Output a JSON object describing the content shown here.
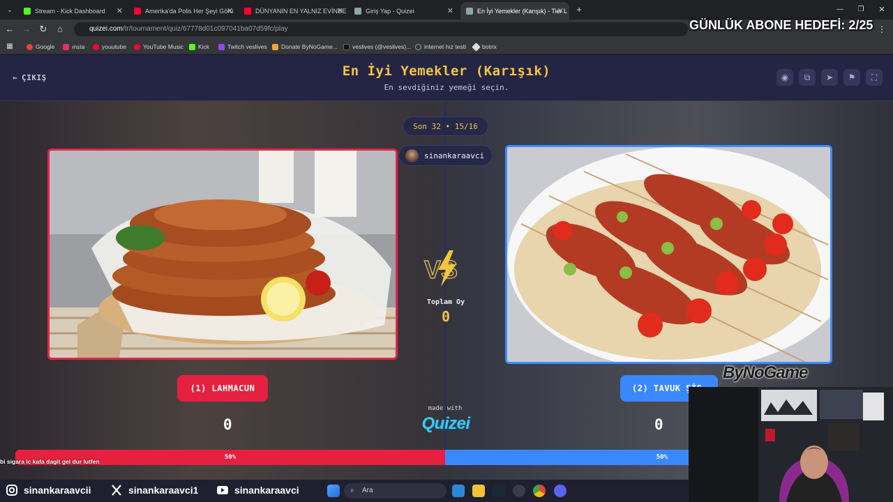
{
  "browser": {
    "tabs": [
      {
        "title": "Stream - Kick Dashboard",
        "color": "#53fc18"
      },
      {
        "title": "Amerika'da Polis Her Şeyi Görü",
        "color": "#ff0033"
      },
      {
        "title": "DÜNYANIN EN YALNIZ EVİNDE",
        "color": "#ff0033"
      },
      {
        "title": "Giriş Yap - Quizei",
        "color": "#9aa0a6"
      },
      {
        "title": "En İyi Yemekler (Karışık) - Tier L",
        "color": "#9aa0a6"
      }
    ],
    "url_host": "quizei.com",
    "url_path": "/tr/tournament/quiz/67778d01c097041ba07d59fc/play",
    "bookmarks": [
      {
        "label": "Google",
        "color": "#ea4335"
      },
      {
        "label": "ınsta",
        "color": "#e1306c"
      },
      {
        "label": "youutube",
        "color": "#ff0033"
      },
      {
        "label": "YouTube Music",
        "color": "#ff0033"
      },
      {
        "label": "Kick",
        "color": "#53fc18"
      },
      {
        "label": "Twitch veslives",
        "color": "#9146ff"
      },
      {
        "label": "Donate ByNoGame...",
        "color": "#f2a33a"
      },
      {
        "label": "veslives (@veslives)...",
        "color": "#111111"
      },
      {
        "label": "internet hız testi",
        "color": "#9aa0a6"
      },
      {
        "label": "botrix",
        "color": "#dddddd"
      }
    ]
  },
  "overlay": {
    "goal": "GÜNLÜK ABONE HEDEFİ: 2/25",
    "ticker": "bi sigara ic kafa dagit gel dur lutfen",
    "sponsor": "ByNoGame"
  },
  "quiz": {
    "exit": "ÇIKIŞ",
    "title": "En İyi Yemekler (Karışık)",
    "subtitle": "En sevdiğiniz yemeği seçin.",
    "round": "Son 32 • 15/16",
    "user": "sinankaraavci",
    "total_label": "Toplam Oy",
    "total_value": "0",
    "made_with": "made with",
    "brand": "Quizei",
    "left": {
      "label": "(1) LAHMACUN",
      "votes": "0",
      "percent": "50%"
    },
    "right": {
      "label": "(2) TAVUK ŞİŞ",
      "votes": "0",
      "percent": "50%"
    }
  },
  "socials": [
    {
      "handle": "sinankaraavcii",
      "icon": "instagram-icon"
    },
    {
      "handle": "sinankaraavci1",
      "icon": "x-icon"
    },
    {
      "handle": "sinankaraavci",
      "icon": "youtube-icon"
    }
  ],
  "taskbar": {
    "search_placeholder": "Ara"
  },
  "colors": {
    "left_accent": "#e5213f",
    "right_accent": "#3a88ff",
    "title": "#f3c63b"
  }
}
